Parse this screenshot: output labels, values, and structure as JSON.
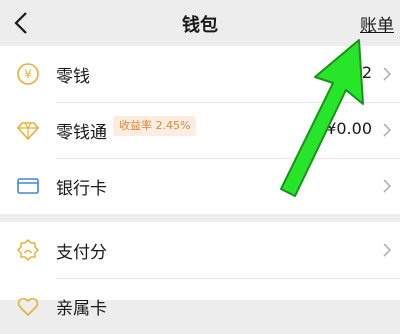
{
  "nav": {
    "title": "钱包",
    "bill_link": "账单",
    "back_icon": "chevron-left-icon"
  },
  "list_primary": [
    {
      "label": "零钱",
      "value": "¥0.22",
      "icon": "yuan-coin-icon"
    },
    {
      "label": "零钱通",
      "badge": "收益率 2.45%",
      "value": "¥0.00",
      "icon": "diamond-icon"
    },
    {
      "label": "银行卡",
      "icon": "bank-card-icon"
    }
  ],
  "list_secondary": [
    {
      "label": "支付分",
      "icon": "pay-score-icon"
    },
    {
      "label": "亲属卡",
      "icon": "heart-icon"
    }
  ],
  "colors": {
    "accent_icon": "#e5b13a",
    "card_icon": "#3d88d6",
    "badge_bg": "#fbeee0",
    "badge_text": "#d88a3b",
    "annotation_arrow": "#27e62a"
  }
}
